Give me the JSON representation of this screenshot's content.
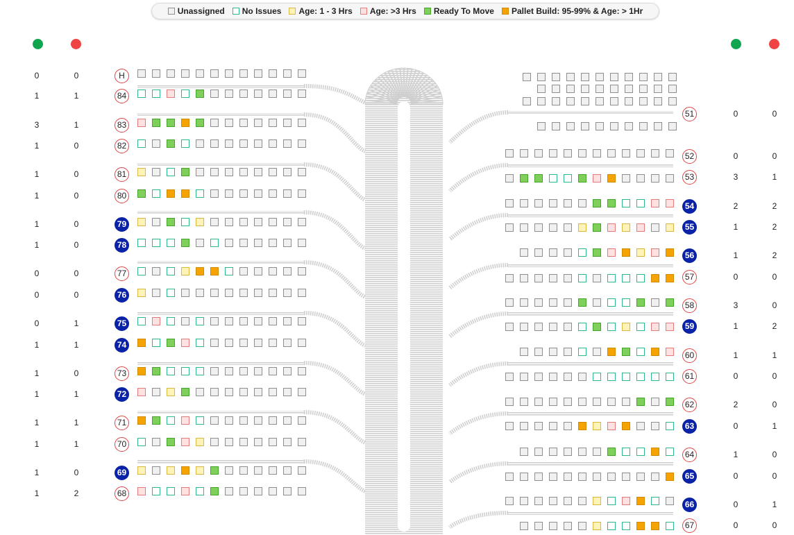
{
  "legend": [
    {
      "key": "unassigned",
      "label": "Unassigned",
      "fill": "#f0f0f0",
      "stroke": "#8e8e8e"
    },
    {
      "key": "noissues",
      "label": "No Issues",
      "fill": "#ffffff",
      "stroke": "#2fb98a"
    },
    {
      "key": "age13",
      "label": "Age: 1 - 3 Hrs",
      "fill": "#fff3b8",
      "stroke": "#d9b842"
    },
    {
      "key": "age3",
      "label": "Age: >3 Hrs",
      "fill": "#ffe1e1",
      "stroke": "#e27b7b"
    },
    {
      "key": "ready",
      "label": "Ready To Move",
      "fill": "#7ed05a",
      "stroke": "#43a62a"
    },
    {
      "key": "pallet",
      "label": "Pallet Build: 95-99% & Age: > 1Hr",
      "fill": "#f5a300",
      "stroke": "#d18900"
    }
  ],
  "colors": {
    "green_dot": "#12a550",
    "red_dot": "#ee4444",
    "badge_outline": "#e04444",
    "badge_filled": "#0a22a8",
    "conveyor": "#cfcfcf"
  },
  "left_doors": [
    {
      "door": "H",
      "green": "0",
      "red": "0",
      "badge": "outline",
      "slots": "UUUUUUUUUUUU"
    },
    {
      "door": "84",
      "green": "1",
      "red": "1",
      "badge": "outline",
      "slots": "NNANRUUUUUUU"
    },
    {
      "door": "83",
      "green": "3",
      "red": "1",
      "badge": "outline",
      "slots": "ARRPRUUUUUUU"
    },
    {
      "door": "82",
      "green": "1",
      "red": "0",
      "badge": "outline",
      "slots": "NURNUUUUUUUU"
    },
    {
      "door": "81",
      "green": "1",
      "red": "0",
      "badge": "outline",
      "slots": "YUNRUUUUUUUU"
    },
    {
      "door": "80",
      "green": "1",
      "red": "0",
      "badge": "outline",
      "slots": "RNPPNUUUUUUU"
    },
    {
      "door": "79",
      "green": "1",
      "red": "0",
      "badge": "filled",
      "slots": "YURNYUUUUUUU"
    },
    {
      "door": "78",
      "green": "1",
      "red": "0",
      "badge": "filled",
      "slots": "NNNRUNUUUUUU"
    },
    {
      "door": "77",
      "green": "0",
      "red": "0",
      "badge": "outline",
      "slots": "NUNYPPNUUUUU"
    },
    {
      "door": "76",
      "green": "0",
      "red": "0",
      "badge": "filled",
      "slots": "YUNUUUUUUUUU"
    },
    {
      "door": "75",
      "green": "0",
      "red": "1",
      "badge": "filled",
      "slots": "NANUNUUUUUUU"
    },
    {
      "door": "74",
      "green": "1",
      "red": "1",
      "badge": "filled",
      "slots": "PNRANUUUUUUU"
    },
    {
      "door": "73",
      "green": "1",
      "red": "0",
      "badge": "outline",
      "slots": "PRNNNUUUUUUU"
    },
    {
      "door": "72",
      "green": "1",
      "red": "1",
      "badge": "filled",
      "slots": "AUYRUUUUUUUU"
    },
    {
      "door": "71",
      "green": "1",
      "red": "1",
      "badge": "outline",
      "slots": "PRNANUUUUUUU"
    },
    {
      "door": "70",
      "green": "1",
      "red": "1",
      "badge": "outline",
      "slots": "NURAYUUUUUUU"
    },
    {
      "door": "69",
      "green": "1",
      "red": "0",
      "badge": "filled",
      "slots": "YUYPYRUUUUUU"
    },
    {
      "door": "68",
      "green": "1",
      "red": "2",
      "badge": "outline",
      "slots": "ANNANRUUUUUU"
    }
  ],
  "right_top_rows": [
    "UUUUUUUUUUU",
    "UUUUUUUUUU",
    "UUUUUUUUUUU",
    "UUUUUUUUUU"
  ],
  "right_doors": [
    {
      "door": "51",
      "green": "0",
      "red": "0",
      "badge": "outline",
      "slots": ""
    },
    {
      "door": "52",
      "green": "0",
      "red": "0",
      "badge": "outline",
      "slots": "UUUUUUUUUUUU"
    },
    {
      "door": "53",
      "green": "3",
      "red": "1",
      "badge": "outline",
      "slots": "URRNNRAPUUUU"
    },
    {
      "door": "54",
      "green": "2",
      "red": "2",
      "badge": "filled",
      "slots": "UUUUUURRNNAA"
    },
    {
      "door": "55",
      "green": "1",
      "red": "2",
      "badge": "filled",
      "slots": "UUUUUYRAYAUY"
    },
    {
      "door": "56",
      "green": "1",
      "red": "2",
      "badge": "filled",
      "slots": "UUUUNRAPYAP"
    },
    {
      "door": "57",
      "green": "0",
      "red": "0",
      "badge": "outline",
      "slots": "UUUUUNUNNNPP"
    },
    {
      "door": "58",
      "green": "3",
      "red": "0",
      "badge": "outline",
      "slots": "UUUUURUNNRUR"
    },
    {
      "door": "59",
      "green": "1",
      "red": "2",
      "badge": "filled",
      "slots": "UUUUUNRNYNAA"
    },
    {
      "door": "60",
      "green": "1",
      "red": "1",
      "badge": "outline",
      "slots": "UUUUNUPRNPA"
    },
    {
      "door": "61",
      "green": "0",
      "red": "0",
      "badge": "outline",
      "slots": "UUUUUUNNNNNN"
    },
    {
      "door": "62",
      "green": "2",
      "red": "0",
      "badge": "outline",
      "slots": "UUUUUUUUURUR"
    },
    {
      "door": "63",
      "green": "0",
      "red": "1",
      "badge": "filled",
      "slots": "UUUUUPYAPUUN"
    },
    {
      "door": "64",
      "green": "1",
      "red": "0",
      "badge": "outline",
      "slots": "UUUUUURNNPN"
    },
    {
      "door": "65",
      "green": "0",
      "red": "0",
      "badge": "filled",
      "slots": "UUUUUUUUUUUP"
    },
    {
      "door": "66",
      "green": "0",
      "red": "1",
      "badge": "filled",
      "slots": "UUUUUUYNAPNU"
    },
    {
      "door": "67",
      "green": "0",
      "red": "0",
      "badge": "outline",
      "slots": "UUUUUYNNPPN"
    }
  ]
}
